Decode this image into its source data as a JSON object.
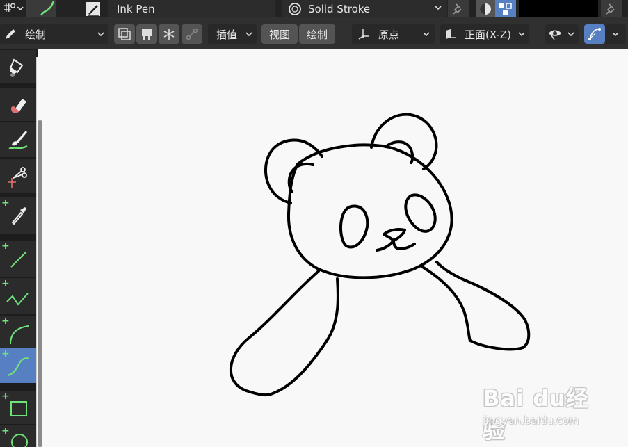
{
  "header_top": {
    "brush_name": "Ink Pen",
    "material_name": "Solid Stroke",
    "icons": [
      "tool-settings-icon",
      "brush-preview-icon",
      "brush-icon",
      "material-sphere-icon",
      "pin-icon",
      "shading-icon",
      "grid-icon",
      "pin-icon"
    ]
  },
  "header_tool": {
    "mode_label": "绘制",
    "interpolation_label": "插值",
    "view_label": "视图",
    "draw_label": "绘制",
    "origin_label": "原点",
    "plane_label": "正面(X-Z)"
  },
  "toolbar": {
    "tools": [
      {
        "name": "fill-tool",
        "icon": "fill-bucket-icon",
        "active": false
      },
      {
        "name": "erase-tool",
        "icon": "eraser-icon",
        "active": false
      },
      {
        "name": "tint-tool",
        "icon": "tint-brush-icon",
        "active": false
      },
      {
        "name": "cutter-tool",
        "icon": "scissors-icon",
        "active": false
      },
      {
        "name": "eyedropper-tool",
        "icon": "eyedropper-icon",
        "active": false
      },
      {
        "name": "line-tool",
        "icon": "line-icon",
        "active": false
      },
      {
        "name": "polyline-tool",
        "icon": "polyline-icon",
        "active": false
      },
      {
        "name": "arc-tool",
        "icon": "arc-icon",
        "active": false
      },
      {
        "name": "curve-tool",
        "icon": "curve-icon",
        "active": true
      },
      {
        "name": "box-tool",
        "icon": "box-icon",
        "active": false
      },
      {
        "name": "circle-tool",
        "icon": "circle-icon",
        "active": false
      }
    ]
  },
  "watermark": {
    "logo_text": "Bai du经验",
    "url": "jingyan.baidu.com"
  },
  "colors": {
    "header_dark": "#232323",
    "header": "#303030",
    "button": "#282828",
    "accent_blue": "#5680c2",
    "add_green": "#6fe37a",
    "canvas": "#f8f8f8",
    "stroke": "#000000"
  }
}
